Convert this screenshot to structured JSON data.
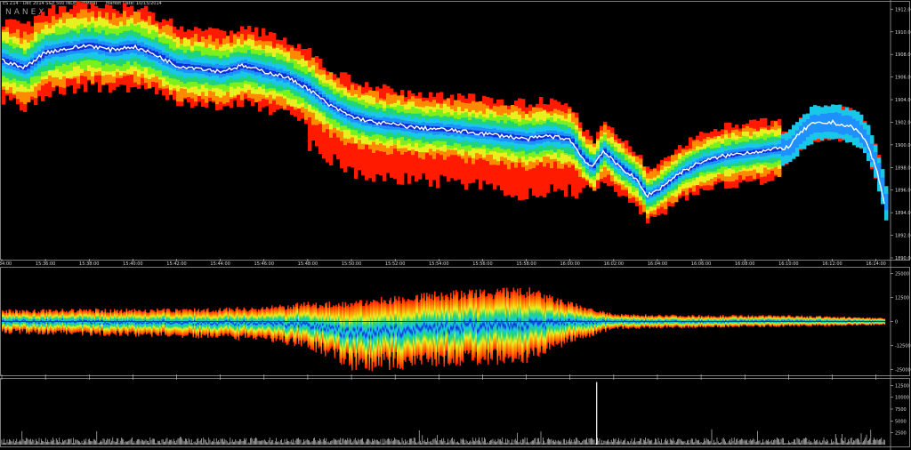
{
  "header": {
    "symbol": "ES Z14 - Dec 2014 S&P 500 INDEX (EMINI)",
    "market_date": "Market Date: 10/15/2014",
    "brand": "NANEX"
  },
  "colors": {
    "background": "#000000",
    "panel_border": "#9a9a9a",
    "price_line": "#ffffff",
    "depth_gradient": [
      "#0b2fd8",
      "#1e90ff",
      "#19c7e6",
      "#20d47a",
      "#7cf01c",
      "#e8f020",
      "#ff8a00",
      "#ff1a00"
    ]
  },
  "chart_data": [
    {
      "panel": "price",
      "type": "heatmap",
      "title": "",
      "xlabel": "",
      "ylabel": "",
      "x_ticks": [
        "15:34:00",
        "15:36:00",
        "15:38:00",
        "15:40:00",
        "15:42:00",
        "15:44:00",
        "15:46:00",
        "15:48:00",
        "15:50:00",
        "15:52:00",
        "15:54:00",
        "15:56:00",
        "15:58:00",
        "16:00:00",
        "16:02:00",
        "16:04:00",
        "16:06:00",
        "16:08:00",
        "16:10:00",
        "16:12:00",
        "16:14:00"
      ],
      "y_ticks": [
        1912.0,
        1910.0,
        1908.0,
        1906.0,
        1904.0,
        1902.0,
        1900.0,
        1898.0,
        1896.0,
        1894.0,
        1892.0,
        1890.0
      ],
      "ylim": [
        1890,
        1912.5
      ],
      "price_series": {
        "name": "",
        "x": [
          "15:34:00",
          "15:35:00",
          "15:36:00",
          "15:37:00",
          "15:38:00",
          "15:39:00",
          "15:40:00",
          "15:41:00",
          "15:42:00",
          "15:43:00",
          "15:44:00",
          "15:45:00",
          "15:46:00",
          "15:47:00",
          "15:48:00",
          "15:49:00",
          "15:50:00",
          "15:51:00",
          "15:52:00",
          "15:53:00",
          "15:54:00",
          "15:55:00",
          "15:56:00",
          "15:57:00",
          "15:58:00",
          "15:59:00",
          "16:00:00",
          "16:00:30",
          "16:01:00",
          "16:01:30",
          "16:02:00",
          "16:03:00",
          "16:03:30",
          "16:04:00",
          "16:05:00",
          "16:06:00",
          "16:07:00",
          "16:08:00",
          "16:09:00",
          "16:10:00",
          "16:10:30",
          "16:11:00",
          "16:12:00",
          "16:13:00",
          "16:13:30",
          "16:14:00",
          "16:14:30"
        ],
        "values": [
          1907.5,
          1906.8,
          1908.2,
          1908.5,
          1908.8,
          1908.4,
          1908.7,
          1908.0,
          1907.0,
          1906.8,
          1906.5,
          1907.0,
          1906.5,
          1906.0,
          1905.0,
          1903.5,
          1902.5,
          1902.0,
          1901.8,
          1901.5,
          1901.4,
          1901.2,
          1901.0,
          1900.8,
          1900.5,
          1900.8,
          1900.5,
          1899.0,
          1898.0,
          1899.5,
          1898.5,
          1897.0,
          1895.5,
          1896.0,
          1897.5,
          1898.5,
          1899.0,
          1899.3,
          1899.5,
          1899.8,
          1901.0,
          1901.8,
          1902.0,
          1901.5,
          1900.5,
          1898.0,
          1894.0
        ]
      },
      "band_spread": [
        3.5,
        3.5,
        3.6,
        3.6,
        3.6,
        3.5,
        3.5,
        3.4,
        3.4,
        3.3,
        3.3,
        3.3,
        3.3,
        3.2,
        3.2,
        3.1,
        3.1,
        3.0,
        3.0,
        3.0,
        3.0,
        3.0,
        3.0,
        3.1,
        3.1,
        3.1,
        3.0,
        2.4,
        2.4,
        2.5,
        2.5,
        2.4,
        2.3,
        2.3,
        2.4,
        2.5,
        2.6,
        2.6,
        2.6,
        2.7,
        2.8,
        2.9,
        2.9,
        2.9,
        2.8,
        2.8,
        2.8
      ]
    },
    {
      "panel": "imbalance",
      "type": "area",
      "title": "",
      "y_ticks": [
        25000,
        12500,
        0,
        -12500,
        -25000
      ],
      "ylim": [
        -27000,
        27000
      ],
      "x": [
        "15:34:00",
        "15:38:00",
        "15:42:00",
        "15:46:00",
        "15:48:00",
        "15:50:00",
        "15:52:00",
        "15:54:00",
        "15:56:00",
        "15:58:00",
        "16:00:00",
        "16:02:00",
        "16:06:00",
        "16:10:00",
        "16:14:00"
      ],
      "upper": [
        5500,
        6000,
        6000,
        7000,
        9000,
        9500,
        12000,
        14000,
        15000,
        16000,
        9000,
        3500,
        3000,
        3000,
        1800
      ],
      "lower": [
        -5500,
        -6500,
        -7500,
        -9000,
        -12500,
        -23000,
        -22000,
        -21000,
        -20000,
        -19000,
        -10000,
        -3500,
        -3000,
        -2500,
        -1800
      ]
    },
    {
      "panel": "volume",
      "type": "bar",
      "title": "",
      "y_ticks": [
        12500,
        10000,
        7500,
        5000,
        2500
      ],
      "ylim": [
        0,
        13500
      ],
      "spike": {
        "x": "16:00:00",
        "value": 13200
      },
      "baseline_typical": 900
    }
  ]
}
